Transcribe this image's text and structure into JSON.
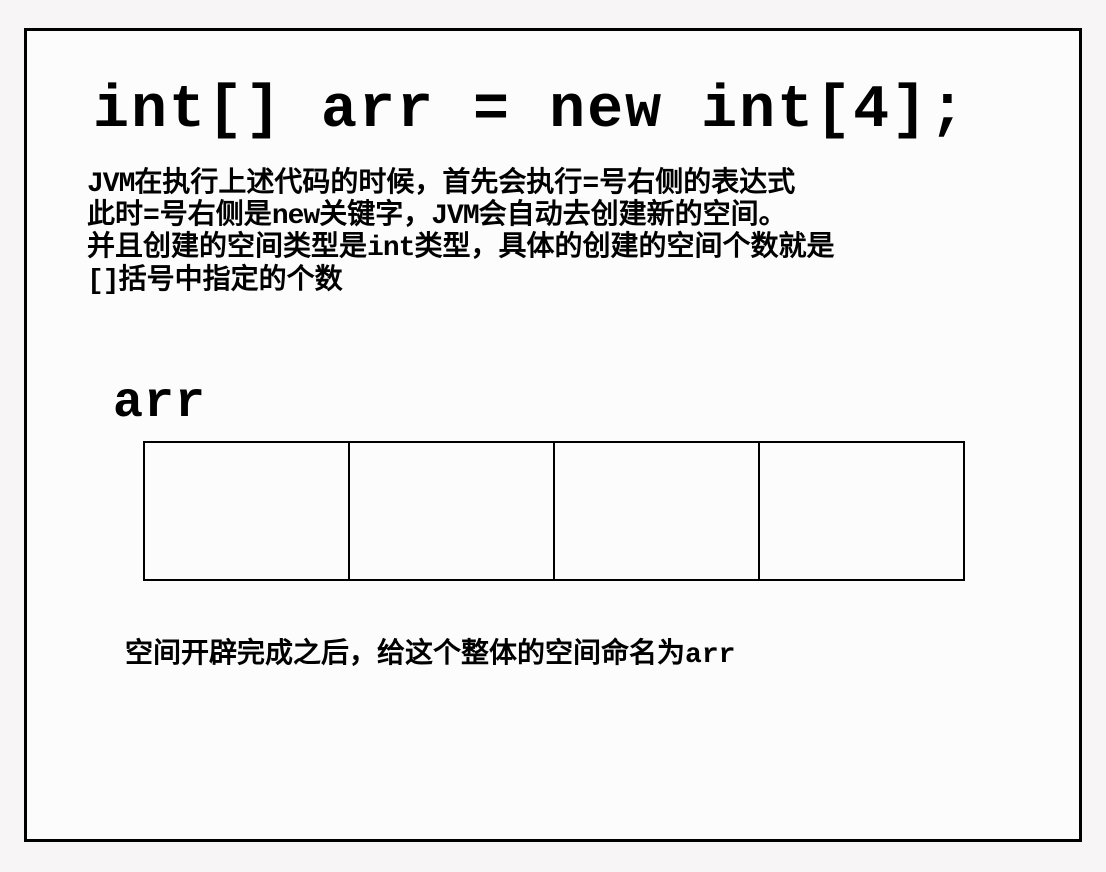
{
  "code_declaration": "int[] arr = new int[4];",
  "explanation": {
    "line1_a": "JVM",
    "line1_b": "在执行上述代码的时候，首先会执行=号右侧的表达式",
    "line2_a": "此时=号右侧是",
    "line2_b": "new",
    "line2_c": "关键字，",
    "line2_d": "JVM",
    "line2_e": "会自动去创建新的空间。",
    "line3_a": "并且创建的空间类型是",
    "line3_b": "int",
    "line3_c": "类型，具体的创建的空间个数就是",
    "line4_a": "[]",
    "line4_b": "括号中指定的个数"
  },
  "array_label": "arr",
  "array_cells": 4,
  "bottom_note_a": "空间开辟完成之后，给这个整体的空间命名为",
  "bottom_note_b": "arr"
}
